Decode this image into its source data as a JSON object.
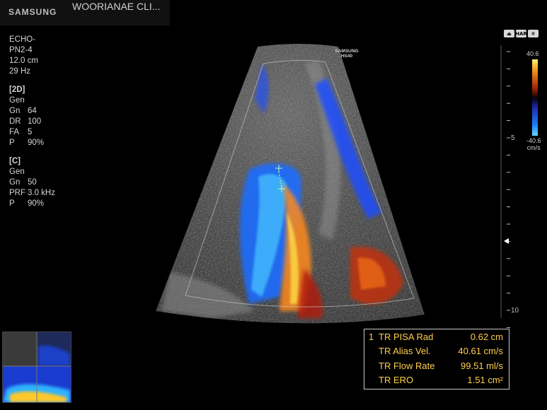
{
  "header": {
    "brand": "SAMSUNG",
    "title": "WOORIANAE CLI..."
  },
  "probe_info": {
    "lines": [
      "ECHO-",
      "PN2-4",
      "12.0 cm",
      "29 Hz"
    ]
  },
  "section_2d": {
    "title": "[2D]",
    "mode": "Gen",
    "params": [
      {
        "key": "Gn",
        "value": "64"
      },
      {
        "key": "DR",
        "value": "100"
      },
      {
        "key": "FA",
        "value": "5"
      },
      {
        "key": "P",
        "value": "90%"
      }
    ]
  },
  "section_c": {
    "title": "[C]",
    "mode": "Gen",
    "params": [
      {
        "key": "Gn",
        "value": "50"
      },
      {
        "key": "PRF",
        "value": "3.0 kHz"
      },
      {
        "key": "P",
        "value": "90%"
      }
    ]
  },
  "device_label": {
    "line1": "SAMSUNG",
    "line2": "HS40"
  },
  "color_scale": {
    "max": "40.6",
    "min": "-40.6",
    "unit": "cm/s"
  },
  "depth_scale": {
    "label_5": "5",
    "label_10": "10"
  },
  "toolbar_icons": [
    "probe-icon",
    "har-icon",
    "snowflake-icon"
  ],
  "toolbar_labels": {
    "har": "HAR",
    "snowflake": "❄",
    "probe": "⏏"
  },
  "measurements": {
    "index": "1",
    "rows": [
      {
        "label": "TR PISA Rad",
        "value": "0.62 cm"
      },
      {
        "label": "TR Alias Vel.",
        "value": "40.61 cm/s"
      },
      {
        "label": "TR Flow Rate",
        "value": "99.51 ml/s"
      },
      {
        "label": "TR ERO",
        "value": "1.51 cm²"
      }
    ]
  },
  "colors": {
    "measurement_text": "#ffcf4d",
    "flow_red": "#b8300e",
    "flow_blue": "#1f5bff"
  }
}
